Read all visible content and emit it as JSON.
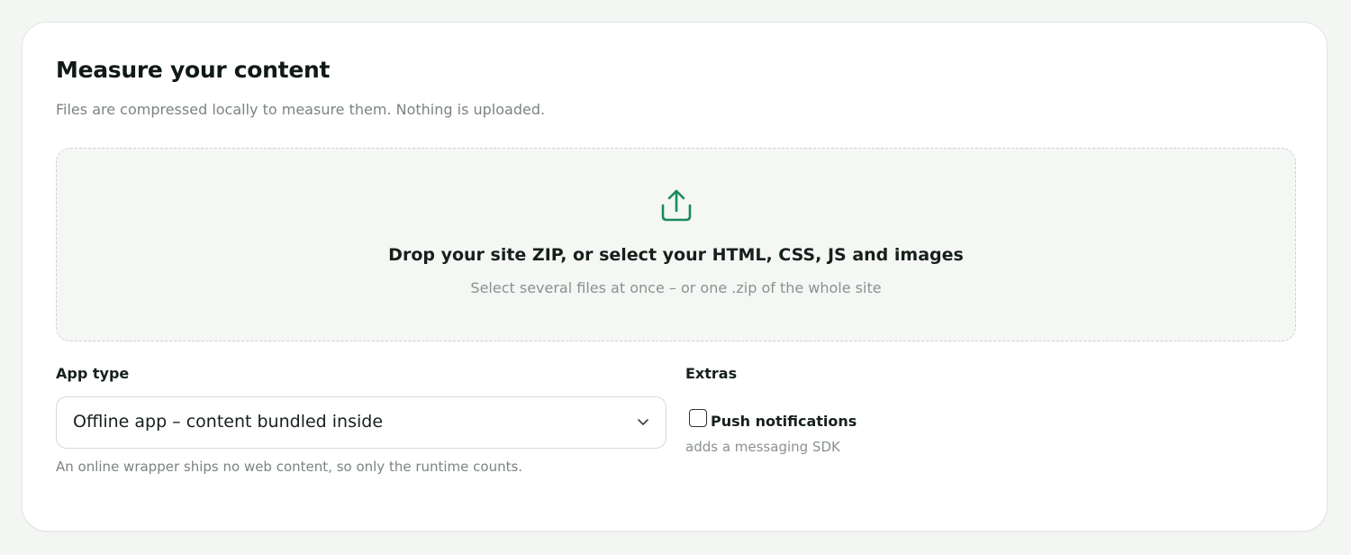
{
  "section": {
    "title": "Measure your content",
    "subtitle": "Files are compressed locally to measure them. Nothing is uploaded."
  },
  "dropzone": {
    "icon": "upload-icon",
    "title": "Drop your site ZIP, or select your HTML, CSS, JS and images",
    "subtitle": "Select several files at once – or one .zip of the whole site"
  },
  "app_type": {
    "label": "App type",
    "selected": "Offline app – content bundled inside",
    "hint": "An online wrapper ships no web content, so only the runtime counts."
  },
  "extras": {
    "label": "Extras",
    "push_notifications": {
      "label": "Push notifications",
      "checked": false,
      "description": "adds a messaging SDK"
    }
  },
  "colors": {
    "accent": "#1a8a5c",
    "background": "#f4f6f4",
    "card": "#ffffff",
    "text": "#16201b",
    "muted": "#7b847f"
  }
}
